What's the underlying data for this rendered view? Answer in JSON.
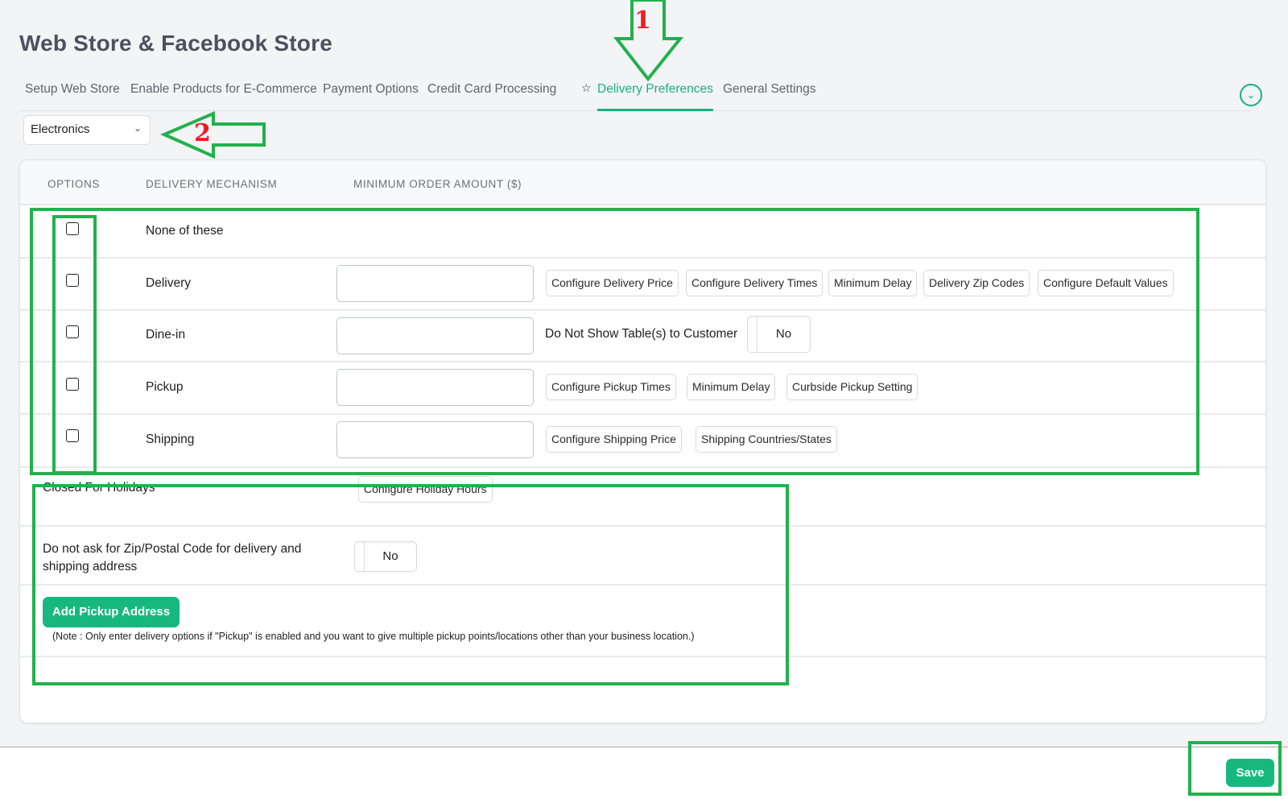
{
  "page": {
    "title": "Web Store & Facebook Store"
  },
  "tabs": [
    {
      "label": "Setup Web Store",
      "active": false
    },
    {
      "label": "Enable Products for E-Commerce",
      "active": false
    },
    {
      "label": "Payment Options",
      "active": false
    },
    {
      "label": "Credit Card Processing",
      "active": false
    },
    {
      "label": "Delivery Preferences",
      "active": true,
      "icon": "star-icon"
    },
    {
      "label": "General Settings",
      "active": false
    }
  ],
  "collapse_icon": "chevron-down-circle-icon",
  "category_select": {
    "value": "Electronics"
  },
  "table": {
    "headers": [
      "OPTIONS",
      "DELIVERY MECHANISM",
      "MINIMUM ORDER AMOUNT ($)"
    ],
    "rows": [
      {
        "mechanism": "None of these",
        "checked": false
      },
      {
        "mechanism": "Delivery",
        "checked": false,
        "amount": "",
        "buttons": [
          "Configure Delivery Price",
          "Configure Delivery Times",
          "Minimum Delay",
          "Delivery Zip Codes",
          "Configure Default Values"
        ]
      },
      {
        "mechanism": "Dine-in",
        "checked": false,
        "amount": "",
        "extra_label": "Do Not Show Table(s) to Customer",
        "toggle": "No"
      },
      {
        "mechanism": "Pickup",
        "checked": false,
        "amount": "",
        "buttons": [
          "Configure Pickup Times",
          "Minimum Delay",
          "Curbside Pickup Setting"
        ]
      },
      {
        "mechanism": "Shipping",
        "checked": false,
        "amount": "",
        "buttons": [
          "Configure Shipping Price",
          "Shipping Countries/States"
        ]
      }
    ]
  },
  "holidays": {
    "label": "Closed For Holidays",
    "button": "Configure Holiday Hours"
  },
  "zip_setting": {
    "label_line1": "Do not ask for Zip/Postal Code for delivery and",
    "label_line2": "shipping address",
    "toggle": "No"
  },
  "pickup_address": {
    "button": "Add Pickup Address",
    "note": "(Note : Only enter delivery options if \"Pickup\" is enabled and you want to give multiple pickup points/locations other than your business location.)"
  },
  "footer": {
    "save_label": "Save"
  },
  "annotations": {
    "marker_1": "1",
    "marker_2": "2"
  },
  "colors": {
    "accent": "#17b27c",
    "annotation_green": "#22b14c",
    "annotation_red": "#ee1c24"
  }
}
